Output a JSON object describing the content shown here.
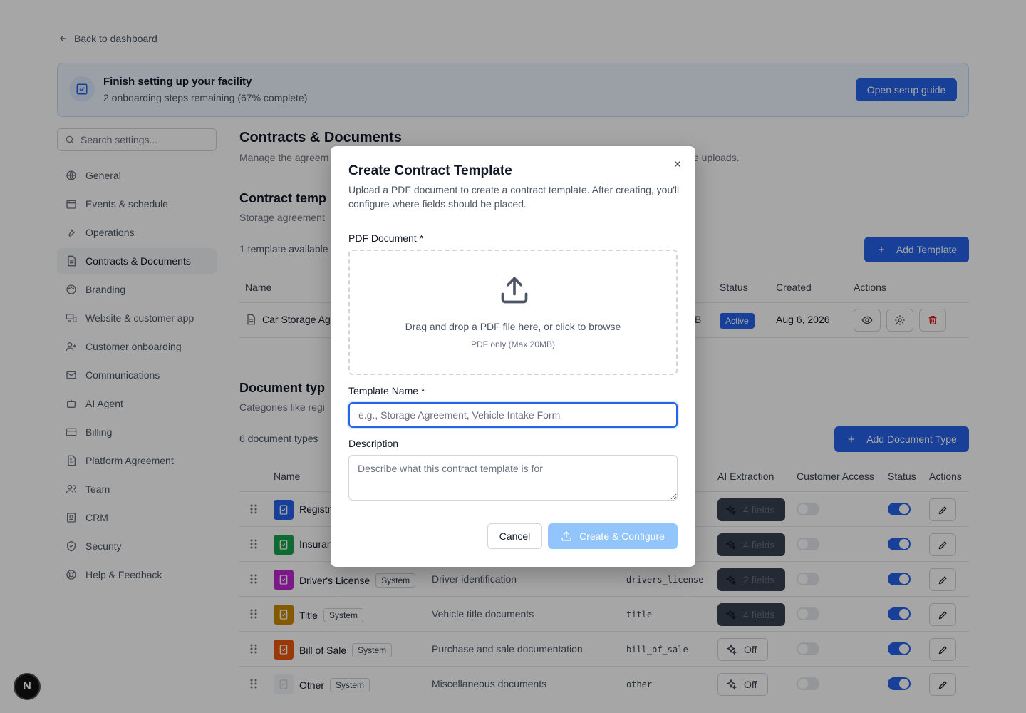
{
  "back_link": "Back to dashboard",
  "banner": {
    "title": "Finish setting up your facility",
    "subtitle": "2 onboarding steps remaining (67% complete)",
    "button": "Open setup guide"
  },
  "sidebar": {
    "search_placeholder": "Search settings...",
    "items": [
      {
        "label": "General",
        "icon": "globe-icon"
      },
      {
        "label": "Events & schedule",
        "icon": "calendar-icon"
      },
      {
        "label": "Operations",
        "icon": "wrench-icon"
      },
      {
        "label": "Contracts & Documents",
        "icon": "file-icon",
        "active": true
      },
      {
        "label": "Branding",
        "icon": "palette-icon"
      },
      {
        "label": "Website & customer app",
        "icon": "devices-icon"
      },
      {
        "label": "Customer onboarding",
        "icon": "user-plus-icon"
      },
      {
        "label": "Communications",
        "icon": "mail-icon"
      },
      {
        "label": "AI Agent",
        "icon": "bot-icon"
      },
      {
        "label": "Billing",
        "icon": "credit-card-icon"
      },
      {
        "label": "Platform Agreement",
        "icon": "file-text-icon"
      },
      {
        "label": "Team",
        "icon": "users-icon"
      },
      {
        "label": "CRM",
        "icon": "contacts-icon"
      },
      {
        "label": "Security",
        "icon": "shield-icon"
      },
      {
        "label": "Help & Feedback",
        "icon": "lifebuoy-icon"
      }
    ]
  },
  "main": {
    "title": "Contracts & Documents",
    "subtitle_left": "Manage the agreem",
    "subtitle_right": "e uploads.",
    "contracts": {
      "title": "Contract temp",
      "subtitle": "Storage agreement",
      "count": "1 template available",
      "add_button": "Add Template",
      "headers": {
        "name": "Name",
        "status": "Status",
        "created": "Created",
        "actions": "Actions"
      },
      "row": {
        "name": "Car Storage Ag",
        "size_tail": "B",
        "status": "Active",
        "created": "Aug 6, 2026"
      }
    },
    "documents": {
      "title": "Document typ",
      "subtitle": "Categories like regi",
      "count": "6 document types",
      "add_button": "Add Document Type",
      "headers": {
        "name": "Name",
        "ai": "AI Extraction",
        "customer": "Customer Access",
        "status": "Status",
        "actions": "Actions"
      },
      "rows": [
        {
          "name": "Registr",
          "badge": "",
          "description": "",
          "code": "",
          "ai": "4 fields",
          "ai_on": true,
          "color": "#2563eb",
          "icon": "file-check-icon"
        },
        {
          "name": "Insuran",
          "badge": "",
          "description": "",
          "code": "",
          "ai": "4 fields",
          "ai_on": true,
          "color": "#16a34a",
          "icon": "shield-icon"
        },
        {
          "name": "Driver's License",
          "badge": "System",
          "description": "Driver identification",
          "code": "drivers_license",
          "ai": "2 fields",
          "ai_on": true,
          "color": "#c026d3",
          "icon": "id-card-icon"
        },
        {
          "name": "Title",
          "badge": "System",
          "description": "Vehicle title documents",
          "code": "title",
          "ai": "4 fields",
          "ai_on": true,
          "color": "#ca8a04",
          "icon": "award-icon"
        },
        {
          "name": "Bill of Sale",
          "badge": "System",
          "description": "Purchase and sale documentation",
          "code": "bill_of_sale",
          "ai": "Off",
          "ai_on": false,
          "color": "#ea580c",
          "icon": "receipt-icon"
        },
        {
          "name": "Other",
          "badge": "System",
          "description": "Miscellaneous documents",
          "code": "other",
          "ai": "Off",
          "ai_on": false,
          "color": "#f3f4f6",
          "icon": "folder-icon"
        }
      ]
    }
  },
  "modal": {
    "title": "Create Contract Template",
    "description": "Upload a PDF document to create a contract template. After creating, you'll configure where fields should be placed.",
    "pdf_label": "PDF Document *",
    "drop_text": "Drag and drop a PDF file here, or click to browse",
    "drop_sub": "PDF only (Max 20MB)",
    "name_label": "Template Name *",
    "name_placeholder": "e.g., Storage Agreement, Vehicle Intake Form",
    "description_label": "Description",
    "description_placeholder": "Describe what this contract template is for",
    "cancel": "Cancel",
    "create": "Create & Configure"
  },
  "fab": "N"
}
